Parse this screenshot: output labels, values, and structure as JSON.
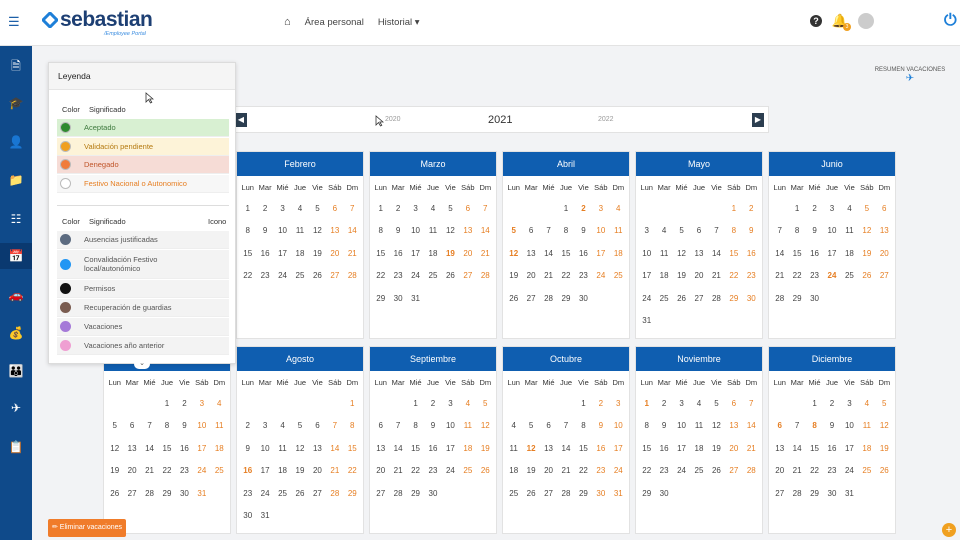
{
  "brand": {
    "name": "sebastian",
    "tagline": "/Employee Portal",
    "accent": "#0f5eb0",
    "orange": "#e67e22"
  },
  "nav": {
    "home_icon": "home-icon",
    "area": "Área personal",
    "historial": "Historial ▾"
  },
  "top": {
    "notifications_count": "3"
  },
  "resumen": {
    "label": "RESUMEN VACACIONES",
    "icon": "plane-icon"
  },
  "year": {
    "prev": "2020",
    "current": "2021",
    "next": "2022"
  },
  "legend": {
    "title": "Leyenda",
    "col_color": "Color",
    "col_meaning": "Significado",
    "col_icon": "Icono",
    "states": [
      {
        "label": "Aceptado",
        "color": "#2e8b2e",
        "bg": "#d8f0d2"
      },
      {
        "label": "Validación pendiente",
        "color": "#f0a020",
        "bg": "#fdf3d8"
      },
      {
        "label": "Denegado",
        "color": "#f07c3a",
        "bg": "#f6dcd6"
      },
      {
        "label": "Festivo Nacional o Autonomico",
        "color": "#ffffff",
        "bg": "#f7f7f7"
      }
    ],
    "types": [
      {
        "label": "Ausencias justificadas",
        "color": "#5c6b80"
      },
      {
        "label": "Convalidación Festivo local/autonómico",
        "color": "#2196f3"
      },
      {
        "label": "Permisos",
        "color": "#111111"
      },
      {
        "label": "Recuperación de guardias",
        "color": "#7a5c50"
      },
      {
        "label": "Vacaciones",
        "color": "#a57ad8"
      },
      {
        "label": "Vacaciones año anterior",
        "color": "#ef9fd2"
      }
    ]
  },
  "dows": [
    "Lun",
    "Mar",
    "Mié",
    "Jue",
    "Vie",
    "Sáb",
    "Dm"
  ],
  "months": [
    {
      "name": "Febrero",
      "offset": 0,
      "days": 28,
      "hol": []
    },
    {
      "name": "Marzo",
      "offset": 0,
      "days": 31,
      "hol": [
        19
      ]
    },
    {
      "name": "Abril",
      "offset": 3,
      "days": 30,
      "hol": [
        2,
        5,
        12
      ]
    },
    {
      "name": "Mayo",
      "offset": 5,
      "days": 31,
      "hol": []
    },
    {
      "name": "Junio",
      "offset": 1,
      "days": 30,
      "hol": [
        24
      ]
    },
    {
      "name": "Agosto",
      "offset": 6,
      "days": 31,
      "hol": [
        16
      ]
    },
    {
      "name": "Septiembre",
      "offset": 2,
      "days": 30,
      "hol": []
    },
    {
      "name": "Octubre",
      "offset": 4,
      "days": 31,
      "hol": [
        12
      ]
    },
    {
      "name": "Noviembre",
      "offset": 0,
      "days": 30,
      "hol": [
        1
      ]
    },
    {
      "name": "Diciembre",
      "offset": 2,
      "days": 31,
      "hol": [
        6,
        8
      ]
    },
    {
      "name": "",
      "offset": 3,
      "days": 31,
      "hol": []
    }
  ],
  "buttons": {
    "delete": "✏ Eliminar vacaciones",
    "fab": "+"
  }
}
